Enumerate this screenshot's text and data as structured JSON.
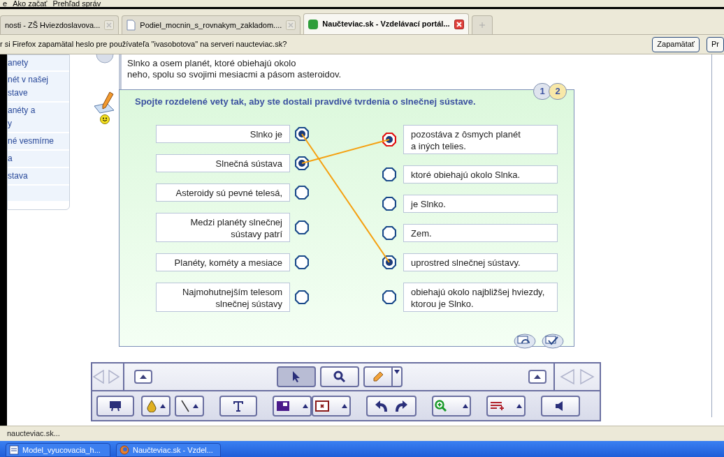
{
  "bookmarks": [
    "e",
    "Ako začať",
    "Prehľad správ"
  ],
  "tabs": [
    {
      "label": "nosti - ZŠ Hviezdoslavova...",
      "selected": false
    },
    {
      "label": "Podiel_mocnin_s_rovnakym_zakladom....",
      "selected": false
    },
    {
      "label": "Naučteviac.sk - Vzdelávací portál...",
      "selected": true
    }
  ],
  "notification": {
    "text": "r si Firefox zapamätal heslo pre používateľa \"ivasobotova\" na serveri naucteviac.sk?",
    "buttons": [
      "Zapamätať",
      "Pr"
    ]
  },
  "sidebar": {
    "items": [
      "anety",
      "nét v našej\nstave",
      "anéty a\ny",
      "né vesmírne",
      "a",
      "stava"
    ]
  },
  "intro": [
    "Slnko a osem planét, ktoré obiehajú okolo",
    "neho, spolu so svojimi mesiacmi a pásom asteroidov."
  ],
  "exercise": {
    "title": "Spojte rozdelené vety tak, aby ste dostali pravdivé tvrdenia o slnečnej sústave.",
    "pages": [
      {
        "label": "1",
        "selected": false
      },
      {
        "label": "2",
        "selected": true
      }
    ],
    "left": [
      {
        "text": "Slnko je",
        "selected": true,
        "links": [
          false,
          false,
          false,
          false,
          true,
          false
        ]
      },
      {
        "text": "Slnečná sústava",
        "selected": true,
        "links": [
          true,
          false,
          false,
          false,
          false,
          false
        ]
      },
      {
        "text": "Asteroidy sú pevné telesá,",
        "selected": false
      },
      {
        "text": "Medzi planéty slnečnej\nsústavy patrí",
        "selected": false
      },
      {
        "text": "Planéty, kométy a mesiace",
        "selected": false
      },
      {
        "text": "Najmohutnejším telesom\nslnečnej sústavy",
        "selected": false
      }
    ],
    "right": [
      {
        "text": "pozostáva z ôsmych planét\na iných telies.",
        "selected": true,
        "flagged": true
      },
      {
        "text": "ktoré obiehajú okolo Slnka.",
        "selected": false,
        "flagged": false
      },
      {
        "text": "je Slnko.",
        "selected": false,
        "flagged": false
      },
      {
        "text": "Zem.",
        "selected": false,
        "flagged": false
      },
      {
        "text": "uprostred slnečnej sústavy.",
        "selected": true,
        "flagged": false
      },
      {
        "text": "obiehajú okolo najbližšej hviezdy,\nktorou je Slnko.",
        "selected": false,
        "flagged": false
      }
    ],
    "kind": "matching"
  },
  "tools": [
    {
      "kind": "pointer",
      "selected": true
    },
    {
      "kind": "zoom",
      "selected": false
    },
    {
      "kind": "pen",
      "selected": false
    }
  ],
  "status_bar": "naucteviac.sk...",
  "taskbar": [
    "Model_vyucovacia_h...",
    "Naučteviac.sk - Vzdel..."
  ]
}
